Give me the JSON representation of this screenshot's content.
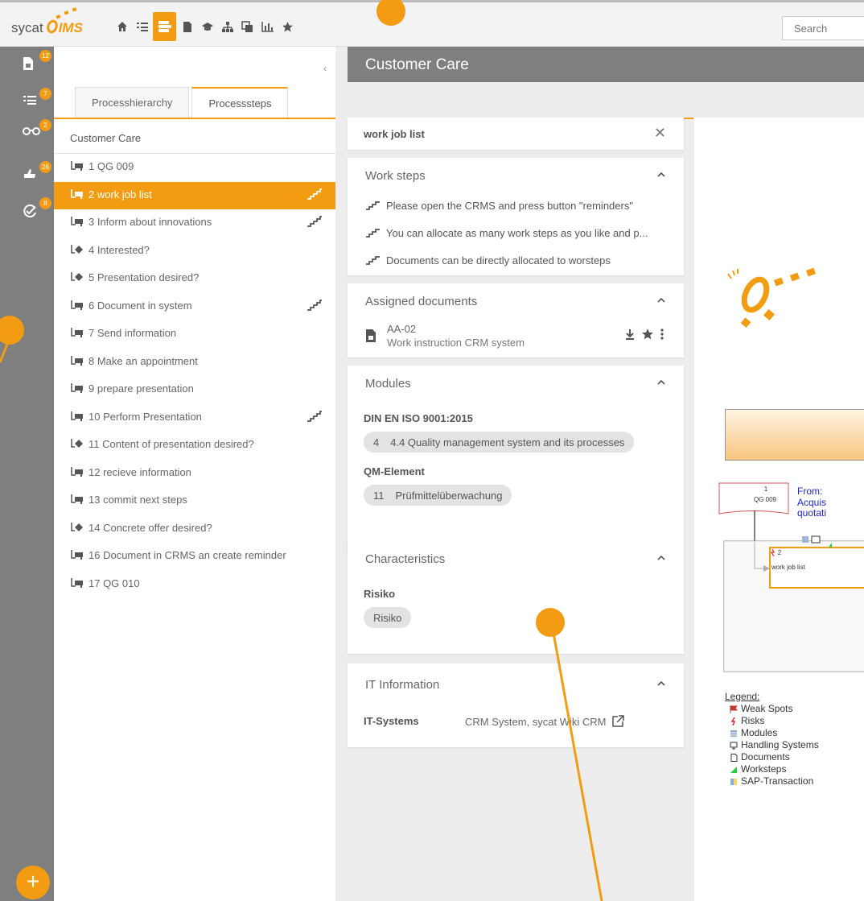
{
  "app": {
    "logo_text": "sycat",
    "logo_accent": "IMS",
    "brand_color": "#f39c12"
  },
  "toolbar": {
    "icons": [
      "home-icon",
      "list-icon",
      "process-icon",
      "document-icon",
      "graduation-icon",
      "hierarchy-icon",
      "copy-icon",
      "chart-icon",
      "star-icon"
    ],
    "active_index": 2
  },
  "search": {
    "placeholder": "Search"
  },
  "sidebar": {
    "items": [
      {
        "icon": "document-icon",
        "badge": "12"
      },
      {
        "icon": "checklist-icon",
        "badge": "7"
      },
      {
        "icon": "glasses-icon",
        "badge": "2"
      },
      {
        "icon": "thumbs-icon",
        "badge": "26"
      },
      {
        "icon": "check-circle-icon",
        "badge": "8"
      }
    ],
    "add_label": "+"
  },
  "nav": {
    "collapse_label": "‹",
    "tabs": [
      "Processhierarchy",
      "Processsteps"
    ],
    "active_tab": 1,
    "tree_title": "Customer Care",
    "items": [
      {
        "label": "1 QG 009",
        "type": "step",
        "has_worksteps": false
      },
      {
        "label": "2 work job list",
        "type": "step",
        "has_worksteps": true
      },
      {
        "label": "3 Inform about innovations",
        "type": "step",
        "has_worksteps": true
      },
      {
        "label": "4 Interested?",
        "type": "decision",
        "has_worksteps": false
      },
      {
        "label": "5 Presentation desired?",
        "type": "decision",
        "has_worksteps": false
      },
      {
        "label": "6 Document in system",
        "type": "step",
        "has_worksteps": true
      },
      {
        "label": "7 Send information",
        "type": "step",
        "has_worksteps": false
      },
      {
        "label": "8 Make an appointment",
        "type": "step",
        "has_worksteps": false
      },
      {
        "label": "9 prepare presentation",
        "type": "step",
        "has_worksteps": false
      },
      {
        "label": "10 Perform Presentation",
        "type": "step",
        "has_worksteps": true
      },
      {
        "label": "11 Content of presentation desired?",
        "type": "decision",
        "has_worksteps": false
      },
      {
        "label": "12 recieve information",
        "type": "step",
        "has_worksteps": false
      },
      {
        "label": "13 commit next steps",
        "type": "step",
        "has_worksteps": false
      },
      {
        "label": "14 Concrete offer desired?",
        "type": "decision",
        "has_worksteps": false
      },
      {
        "label": "16 Document in CRMS an create reminder",
        "type": "step",
        "has_worksteps": false
      },
      {
        "label": "17 QG 010",
        "type": "step",
        "has_worksteps": false
      }
    ],
    "active_item": 1
  },
  "page": {
    "title": "Customer Care"
  },
  "detail": {
    "title": "work job list",
    "close_label": "✕",
    "work_steps": {
      "header": "Work steps",
      "items": [
        "Please open the CRMS and press button \"reminders\"",
        "You can allocate as many work steps as you like and p...",
        "Documents can be directly allocated to worsteps"
      ]
    },
    "documents": {
      "header": "Assigned documents",
      "items": [
        {
          "id": "AA-02",
          "title": "Work instruction CRM system"
        }
      ]
    },
    "modules": {
      "header": "Modules",
      "groups": [
        {
          "name": "DIN EN ISO 9001:2015",
          "chips": [
            {
              "num": "4",
              "label": "4.4 Quality management system and its processes"
            }
          ]
        },
        {
          "name": "QM-Element",
          "chips": [
            {
              "num": "11",
              "label": "Prüfmittelüberwachung"
            }
          ]
        }
      ]
    },
    "characteristics": {
      "header": "Characteristics",
      "group": "Risiko",
      "chip": "Risiko"
    },
    "it": {
      "header": "IT Information",
      "key": "IT-Systems",
      "value": "CRM System, sycat Wiki CRM"
    }
  },
  "diagram": {
    "prev_num": "1",
    "prev_label": "QG 009",
    "from_label": "From:",
    "from_sub1": "Acquis",
    "from_sub2": "quotati",
    "cur_num": "2",
    "cur_label": "work job list",
    "legend_title": "Legend:",
    "legend": [
      "Weak Spots",
      "Risks",
      "Modules",
      "Handling Systems",
      "Documents",
      "Worksteps",
      "SAP-Transaction"
    ]
  }
}
